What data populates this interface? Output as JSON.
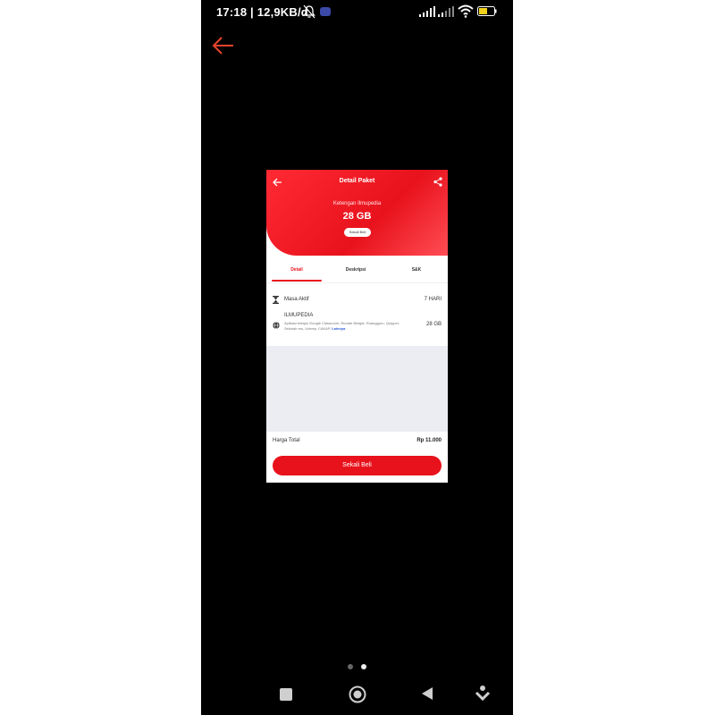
{
  "status_bar": {
    "time_text": "17:18 | 12,9KB/d",
    "battery_level": "49"
  },
  "inner_app": {
    "header": {
      "title": "Detail Paket",
      "package_name": "Ketengan Ilmupedia",
      "package_size": "28 GB",
      "pill_label": "Sekali Beli"
    },
    "tabs": [
      {
        "label": "Detail",
        "active": true
      },
      {
        "label": "Deskripsi",
        "active": false
      },
      {
        "label": "S&K",
        "active": false
      }
    ],
    "details": {
      "masa_aktif_label": "Masa Aktif",
      "masa_aktif_value": "7 HARI",
      "ilmupedia_title": "ILMUPEDIA",
      "ilmupedia_desc": "Aplikasi belajar Google Classroom, Rumah Belajar, Ruangguru, Quipper, Sekolah.mu, Udemy, CAKAP,",
      "ilmupedia_more": "Lainnya",
      "ilmupedia_value": "28 GB"
    },
    "footer": {
      "total_label": "Harga Total",
      "total_value": "Rp 11.000",
      "buy_button_label": "Sekali Beli"
    }
  },
  "colors": {
    "brand_red": "#e8121c",
    "link_blue": "#2b5bd7",
    "back_arrow_orange": "#e8432b"
  },
  "icons": [
    "back-arrow-icon",
    "bell-muted-icon",
    "signal-icon",
    "wifi-icon",
    "battery-icon",
    "share-icon",
    "hourglass-icon",
    "globe-icon",
    "nav-recent-icon",
    "nav-home-icon",
    "nav-back-icon",
    "nav-assist-icon"
  ],
  "pager": {
    "count": 2,
    "active_index": 1
  }
}
